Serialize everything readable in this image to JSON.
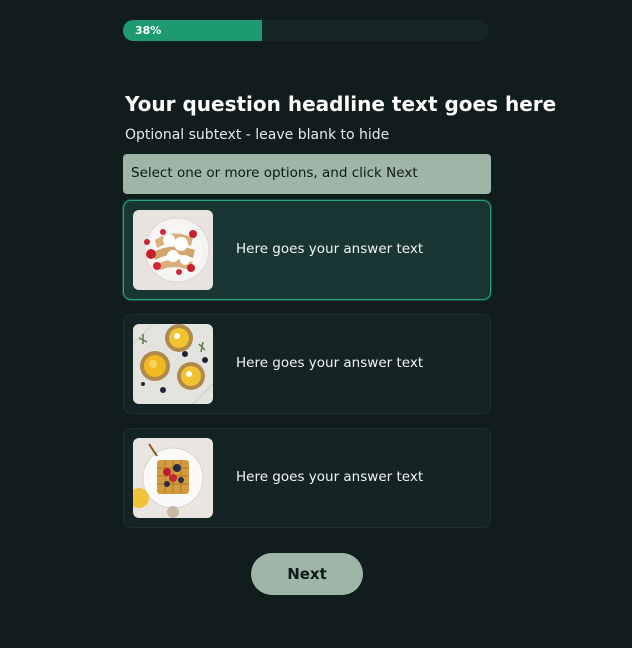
{
  "progress": {
    "percent": 38,
    "label": "38%"
  },
  "question": {
    "headline": "Your question headline text goes here",
    "subtext": "Optional subtext - leave blank to hide",
    "instruction": "Select one or more options, and click Next"
  },
  "options": [
    {
      "text": "Here goes your answer text",
      "image": "crepes-with-strawberries-photo",
      "selected": true
    },
    {
      "text": "Here goes your answer text",
      "image": "lemon-tarts-photo",
      "selected": false
    },
    {
      "text": "Here goes your answer text",
      "image": "waffle-with-berries-photo",
      "selected": false
    }
  ],
  "next_button": {
    "label": "Next"
  },
  "colors": {
    "background": "#111c1c",
    "progress_fill": "#1e9a73",
    "accent_border": "#23a57a",
    "button": "#9fb5a8"
  }
}
